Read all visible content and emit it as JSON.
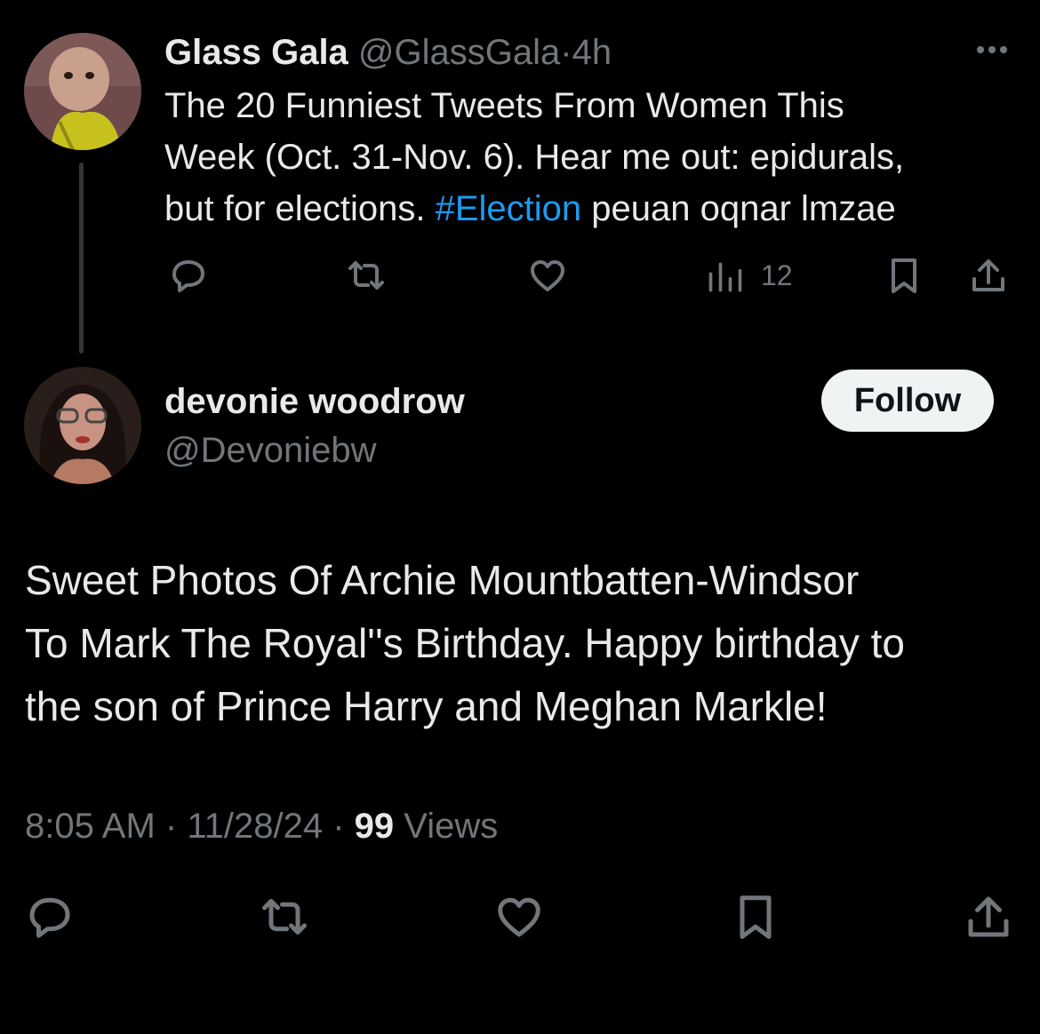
{
  "tweet1": {
    "author_name": "Glass Gala",
    "author_handle": "@GlassGala",
    "separator": "·",
    "time": "4h",
    "text_lines": [
      "The 20 Funniest Tweets From Women This",
      "Week (Oct. 31-Nov. 6). Hear me out: epidurals,",
      "but for elections. "
    ],
    "hashtag": "#Election",
    "text_tail": " peuan oqnar lmzae",
    "views": "12",
    "icons": [
      "reply-icon",
      "retweet-icon",
      "like-icon",
      "views-icon",
      "bookmark-icon",
      "share-icon"
    ]
  },
  "tweet2": {
    "author_name": "devonie woodrow",
    "author_handle": "@Devoniebw",
    "follow_label": "Follow",
    "text_lines": [
      "Sweet Photos Of Archie Mountbatten-Windsor",
      "To Mark The Royal''s Birthday. Happy birthday to",
      "the son of Prince Harry and Meghan Markle!"
    ],
    "time": "8:05 AM",
    "date": "11/28/24",
    "separator": "·",
    "views_count": "99",
    "views_label": "Views",
    "icons": [
      "reply-icon",
      "retweet-icon",
      "like-icon",
      "bookmark-icon",
      "share-icon"
    ]
  },
  "colors": {
    "background": "#000000",
    "text": "#e7e9ea",
    "muted": "#71767b",
    "accent": "#1d9bf0",
    "button_bg": "#eff3f4"
  }
}
